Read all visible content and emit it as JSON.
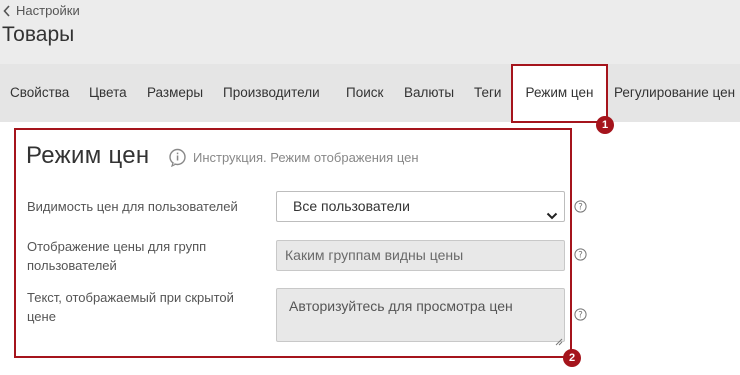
{
  "header": {
    "back_label": "Настройки",
    "page_title": "Товары"
  },
  "tabs": [
    {
      "label": "Свойства",
      "active": false
    },
    {
      "label": "Цвета",
      "active": false
    },
    {
      "label": "Размеры",
      "active": false
    },
    {
      "label": "Производители",
      "active": false
    },
    {
      "label": "Поиск",
      "active": false
    },
    {
      "label": "Валюты",
      "active": false
    },
    {
      "label": "Теги",
      "active": false
    },
    {
      "label": "Режим цен",
      "active": true
    },
    {
      "label": "Регулирование цен",
      "active": false
    }
  ],
  "section": {
    "title": "Режим цен",
    "instruction_link": "Инструкция. Режим отображения цен",
    "fields": {
      "visibility": {
        "label": "Видимость цен для пользователей",
        "value": "Все пользователи"
      },
      "groups": {
        "label": "Отображение цены для групп пользователей",
        "placeholder": "Каким группам видны цены"
      },
      "hidden_text": {
        "label": "Текст, отображаемый при скрытой цене",
        "value": "Авторизуйтесь для просмотра цен"
      }
    }
  },
  "annotations": [
    {
      "number": "1"
    },
    {
      "number": "2"
    }
  ],
  "colors": {
    "highlight": "#a5141c",
    "tabs_background": "#e5e5e5",
    "header_background": "#ececec"
  },
  "icons": {
    "back": "chevron-left-icon",
    "instruction": "info-bubble-icon",
    "help": "question-circle-icon",
    "select": "chevron-down-icon",
    "resize": "resize-grip-icon"
  }
}
